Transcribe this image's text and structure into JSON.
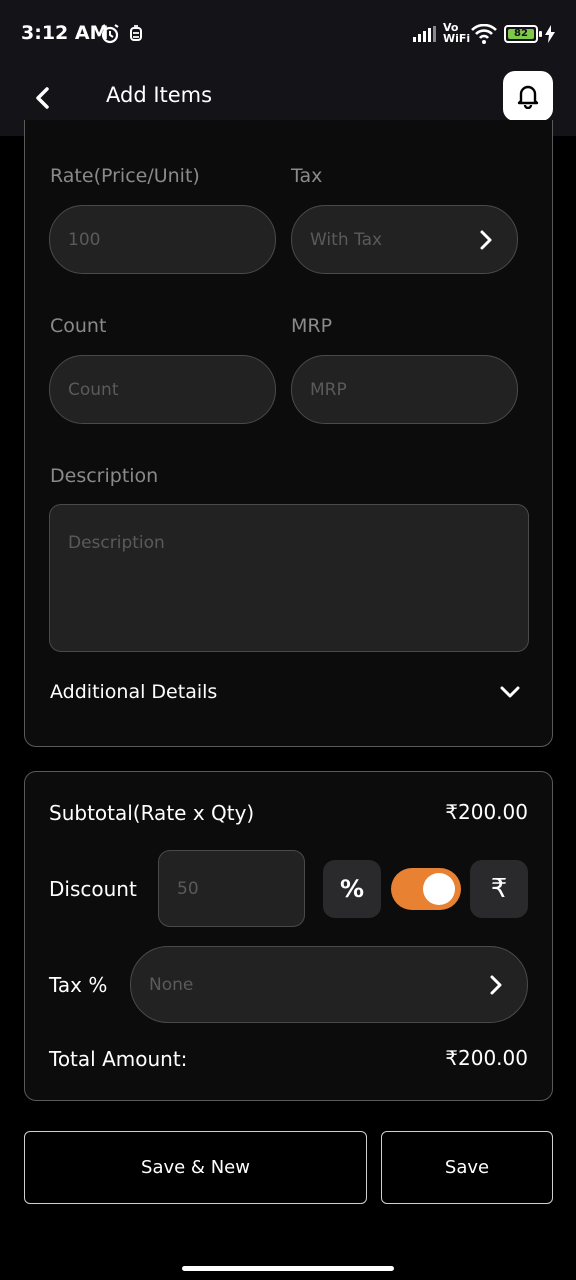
{
  "status_bar": {
    "time": "3:12 AM",
    "network": "Vo\nWiFi",
    "battery": "82",
    "icons": [
      "alarm-icon",
      "notification-icon",
      "signal-icon",
      "wifi-icon",
      "battery-icon",
      "charging-icon"
    ]
  },
  "header": {
    "title": "Add Items",
    "back_icon": "back-chevron-icon",
    "bell_icon": "bell-icon"
  },
  "form": {
    "rate_label": "Rate(Price/Unit)",
    "rate_placeholder": "100",
    "tax_label": "Tax",
    "tax_placeholder": "With Tax",
    "count_label": "Count",
    "count_placeholder": "Count",
    "mrp_label": "MRP",
    "mrp_placeholder": "MRP",
    "description_label": "Description",
    "description_placeholder": "Description",
    "additional_details": "Additional Details"
  },
  "summary": {
    "subtotal_label": "Subtotal(Rate x Qty)",
    "subtotal_value": "₹200.00",
    "discount_label": "Discount",
    "discount_placeholder": "50",
    "percent_symbol": "%",
    "rupee_symbol": "₹",
    "toggle_on": true,
    "tax_label": "Tax %",
    "tax_placeholder": "None",
    "total_label": "Total Amount:",
    "total_value": "₹200.00"
  },
  "buttons": {
    "save_new": "Save & New",
    "save": "Save"
  },
  "colors": {
    "accent": "#e98132",
    "background": "#000000",
    "input_bg": "#222223"
  }
}
